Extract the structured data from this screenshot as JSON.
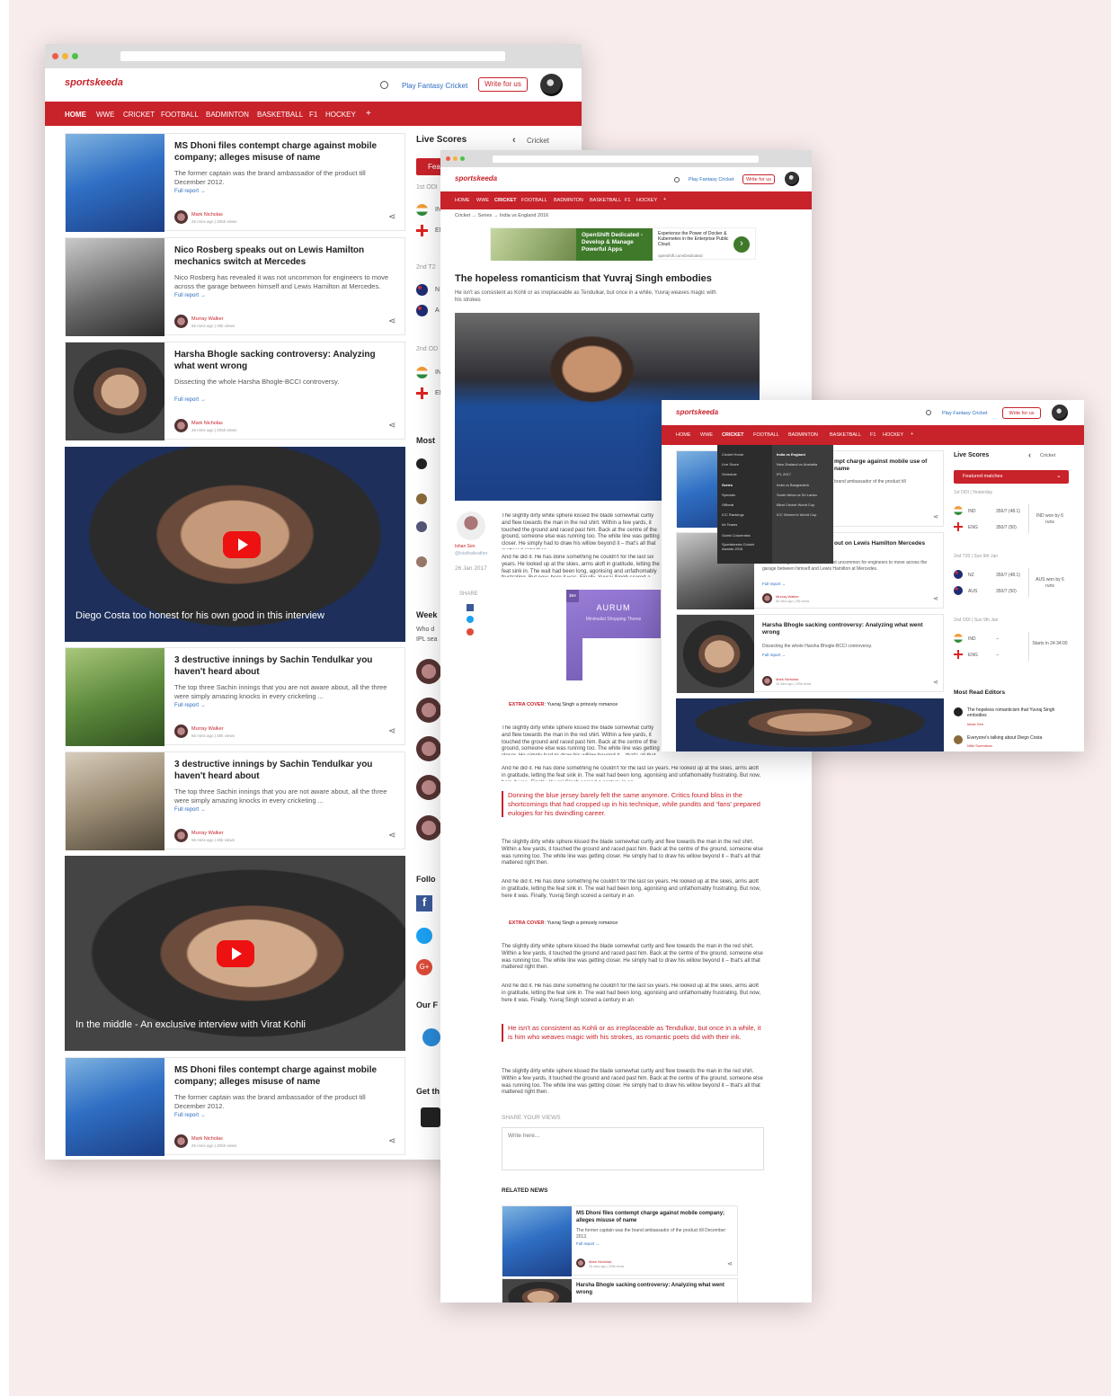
{
  "brand": {
    "logo": "sportskeeda",
    "fantasy": "Play Fantasy Cricket",
    "write": "Write for us",
    "accent": "#c8222a"
  },
  "nav": {
    "home": "HOME",
    "wwe": "WWE",
    "cricket": "CRICKET",
    "football": "FOOTBALL",
    "badminton": "BADMINTON",
    "basketball": "BASKETBALL",
    "f1": "F1",
    "hockey": "HOCKEY",
    "plus": "+"
  },
  "common": {
    "full_report": "Full report",
    "arrow": "→"
  },
  "w1": {
    "cards": [
      {
        "title": "MS Dhoni files contempt charge against mobile company; alleges misuse of name",
        "desc": "The former captain was the brand ambassador of the product till December 2012.",
        "author": "Mark Nicholas",
        "meta": "26 mins ago  |  205k views"
      },
      {
        "title": "Nico Rosberg speaks out on Lewis Hamilton mechanics switch at Mercedes",
        "desc": "Nico Rosberg has revealed it was not uncommon for engineers to move across the garage between himself and Lewis Hamilton at Mercedes.",
        "author": "Murray Walker",
        "meta": "56 mins ago  |  25k views"
      },
      {
        "title": "Harsha Bhogle sacking controversy: Analyzing what went wrong",
        "desc": "Dissecting the whole Harsha Bhogle-BCCI controversy.",
        "author": "Mark Nicholas",
        "meta": "26 mins ago  |  205k views"
      },
      {
        "title": "3 destructive innings by Sachin Tendulkar you haven't heard about",
        "desc": "The top three Sachin innings that you are not aware about, all the three were simply amazing knocks in every cricketing ...",
        "author": "Murray Walker",
        "meta": "56 mins ago  |  25k views"
      },
      {
        "title": "3 destructive innings by Sachin Tendulkar you haven't heard about",
        "desc": "The top three Sachin innings that you are not aware about, all the three were simply amazing knocks in every cricketing ...",
        "author": "Murray Walker",
        "meta": "56 mins ago  |  25k views"
      },
      {
        "title": "MS Dhoni files contempt charge against mobile company; alleges misuse of name",
        "desc": "The former captain was the brand ambassador of the product till December 2012.",
        "author": "Mark Nicholas",
        "meta": "26 mins ago  |  205k views"
      }
    ],
    "videos": [
      "Diego Costa too honest for his own good in this interview",
      "In the middle - An exclusive interview with Virat Kohli"
    ],
    "side": {
      "live_scores": "Live Scores",
      "cricket": "Cricket",
      "feat": "Fea",
      "odi1": "1st ODI",
      "in1": "IN",
      "en1": "EN",
      "t20": "2nd T2",
      "nz": "N",
      "au": "A",
      "odi2": "2nd OD",
      "in2": "IN",
      "en2": "EN",
      "most": "Most",
      "week": "Week",
      "who": "Who d",
      "ipl": "IPL sea",
      "follow": "Follo",
      "our": "Our F",
      "get": "Get th"
    }
  },
  "w2": {
    "breadcrumb": "Cricket  →  Series  →  India vs England 2016",
    "ad": {
      "left": "OpenShift Dedicated - Develop & Manage Powerful Apps",
      "right": "Experience the Power of Docker & Kubernetes in the Enterprise Public Cloud.",
      "url": "openshift.com/Dedicated"
    },
    "title": "The hopeless romanticism that Yuvraj Singh embodies",
    "subtitle": "He isn't as consistent as Kohli or as irreplaceable as Tendulkar, but once in a while, Yuvraj weaves magic with his strokes",
    "author": "Ishan Sen",
    "handle": "@lotsthatleather",
    "date": "26 Jan 2017",
    "share": "SHARE",
    "p1": "The slightly dirty white sphere kissed the blade somewhat curtly and flew towards the man in the red shirt. Within a few yards, it touched the ground and raced past him. Back at the centre of the ground, someone else was running too. The white line was getting closer. He simply had to draw his willow beyond it – that's all that mattered right then.",
    "p2": "And he did it. He has done something he couldn't for the last six years. He looked up at the skies, arms aloft in gratitude, letting the feat sink in. The wait had been long, agonising and unfathomably frustrating. But now, here it was. Finally, Yuvraj Singh scored a century in an",
    "aurum": {
      "title": "AURUM",
      "sub": "Minimalist Shopping Theme",
      "badge": "$69"
    },
    "extra": "EXTRA COVER",
    "extra_text": ": Yuvraj Singh a princely romance",
    "q1": "Donning the blue jersey barely felt the same anymore. Critics found bliss in the shortcomings that had cropped up in his technique, while pundits and 'fans' prepared eulogies for his dwindling career.",
    "q2": "He isn't as consistent as Kohli or as irreplaceable as Tendulkar, but once in a while, it is him who weaves magic with his strokes, as romantic poets did with their ink.",
    "share_views": "SHARE YOUR VIEWS",
    "placeholder": "Write here...",
    "related": "RELATED NEWS",
    "rel": [
      {
        "title": "MS Dhoni files contempt charge against mobile company; alleges misuse of name",
        "desc": "The former captain was the brand ambassador of the product till December 2012.",
        "author": "Mark Nicholas",
        "meta": "26 mins ago  |  205k views"
      },
      {
        "title": "Harsha Bhogle sacking controversy: Analyzing what went wrong"
      }
    ]
  },
  "w3": {
    "menu_left": [
      "Cricket Home",
      "Live Score",
      "Schedule",
      "Series",
      "Specials",
      "Offbeat",
      "ICC Rankings",
      "Int Teams",
      "Guest Columnists",
      "Sportskeeda Cricket Awards 2016"
    ],
    "menu_right": [
      "India vs England",
      "New Zealand vs Australia",
      "IPL 2017",
      "India vs Bangladesh",
      "South Africa vs Sri Lanka",
      "Blind Cricket World Cup",
      "ICC Women's World Cup"
    ],
    "cards": [
      {
        "title": "MS Dhoni files contempt charge against mobile company; alleges misuse of name",
        "title_vis": "mpt charge against mobile use of name",
        "desc_vis": "brand ambassador of the product till"
      },
      {
        "title_vis": "out on Lewis Hamilton Mercedes",
        "desc": "Nico Rosberg has revealed it was not uncommon for engineers to move across the garage between himself and Lewis Hamilton at Mercedes.",
        "author": "Murray Walker",
        "meta": "56 mins ago  |  25k views"
      },
      {
        "title": "Harsha Bhogle sacking controversy: Analyzing what went wrong",
        "desc": "Dissecting the whole Harsha Bhogle-BCCI controversy.",
        "author": "Mark Nicholas",
        "meta": "26 mins ago  |  205k views"
      }
    ],
    "side": {
      "title": "Live Scores",
      "cricket": "Cricket",
      "featured": "Featured matches",
      "m1": {
        "label": "1st ODI  |  Yesterday",
        "t1": "IND",
        "s1": "356/7 (48.1)",
        "t2": "ENG",
        "s2": "350/7 (50)",
        "res": "IND won by 6 runs"
      },
      "m2": {
        "label": "2nd T20  |  Sun 9th Jan",
        "t1": "NZ",
        "s1": "356/7 (48.1)",
        "t2": "AUS",
        "s2": "350/7 (50)",
        "res": "AUS won by 6 runs"
      },
      "m3": {
        "label": "2nd ODI  |  Sun 9th Jan",
        "t1": "IND",
        "s1": "--",
        "t2": "ENG",
        "s2": "--",
        "res": "Starts in 24:34:00"
      },
      "most": "Most Read Editors",
      "r1": "The hopeless romanticism that Yuvraj Singh embodies",
      "r1a": "Ishan Sen",
      "r2": "Everyone's talking about Diego Costa",
      "r2a": "Nitin Surendran"
    }
  }
}
